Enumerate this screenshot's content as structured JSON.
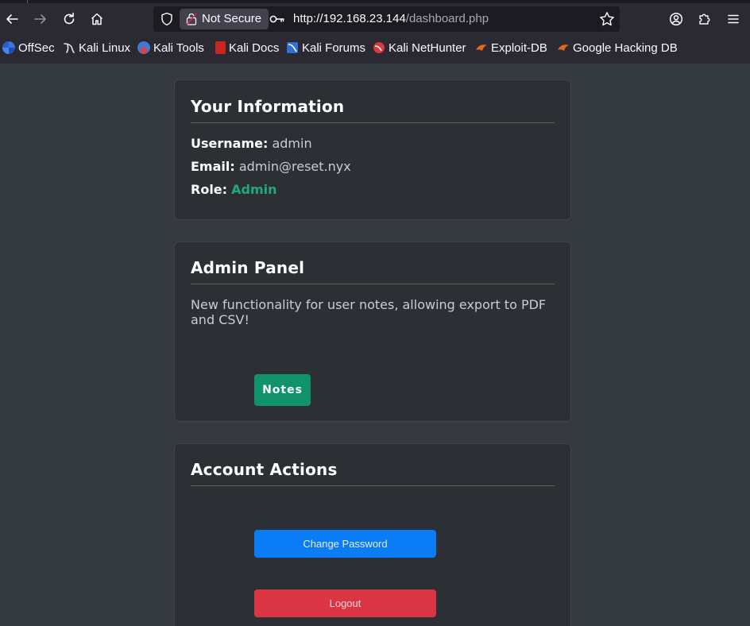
{
  "browser": {
    "not_secure_label": "Not Secure",
    "url_host": "http://192.168.23.144",
    "url_path": "/dashboard.php",
    "bookmarks": [
      {
        "label": "OffSec",
        "icon": "offsec-icon"
      },
      {
        "label": "Kali Linux",
        "icon": "kali-dragon-icon"
      },
      {
        "label": "Kali Tools",
        "icon": "kali-tools-icon"
      },
      {
        "label": "Kali Docs",
        "icon": "kali-docs-icon"
      },
      {
        "label": "Kali Forums",
        "icon": "kali-forums-icon"
      },
      {
        "label": "Kali NetHunter",
        "icon": "nethunter-icon"
      },
      {
        "label": "Exploit-DB",
        "icon": "exploit-db-icon"
      },
      {
        "label": "Google Hacking DB",
        "icon": "ghdb-icon"
      }
    ]
  },
  "info_card": {
    "title": "Your Information",
    "username_label": "Username:",
    "username_value": "admin",
    "email_label": "Email:",
    "email_value": "admin@reset.nyx",
    "role_label": "Role:",
    "role_value": "Admin"
  },
  "admin_card": {
    "title": "Admin Panel",
    "description": "New functionality for user notes, allowing export to PDF and CSV!",
    "notes_button": "Notes"
  },
  "actions_card": {
    "title": "Account Actions",
    "change_password_button": "Change Password",
    "logout_button": "Logout"
  },
  "colors": {
    "page_bg": "#343a40",
    "card_bg": "#2c3035",
    "role_green": "#20a978",
    "notes_green": "#10936b",
    "primary_blue": "#097cf6",
    "danger_red": "#db3444"
  }
}
